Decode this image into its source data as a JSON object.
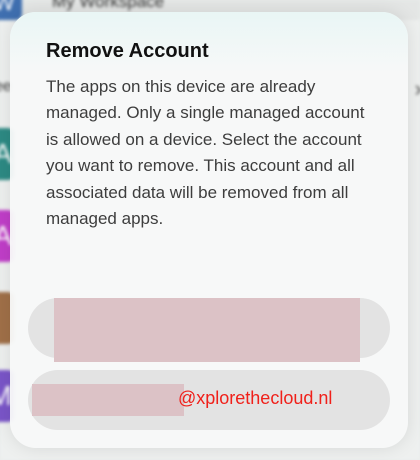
{
  "background": {
    "workspace_icon_letter": "W",
    "workspace_title": "My Workspace",
    "left_text": "ee",
    "chevron_glyph": "›",
    "tiles": [
      "A",
      "A",
      "",
      "M"
    ]
  },
  "dialog": {
    "title": "Remove Account",
    "message": "The apps on this device are already managed.  Only a single managed account is allowed on a device. Select the account you want to remove. This account and all associated data will be removed from all managed apps.",
    "option1_label": "",
    "option2_label": ""
  },
  "watermark": "@xplorethecloud.nl",
  "colors": {
    "watermark": "#f0201a",
    "redaction": "#dcc2c6"
  }
}
